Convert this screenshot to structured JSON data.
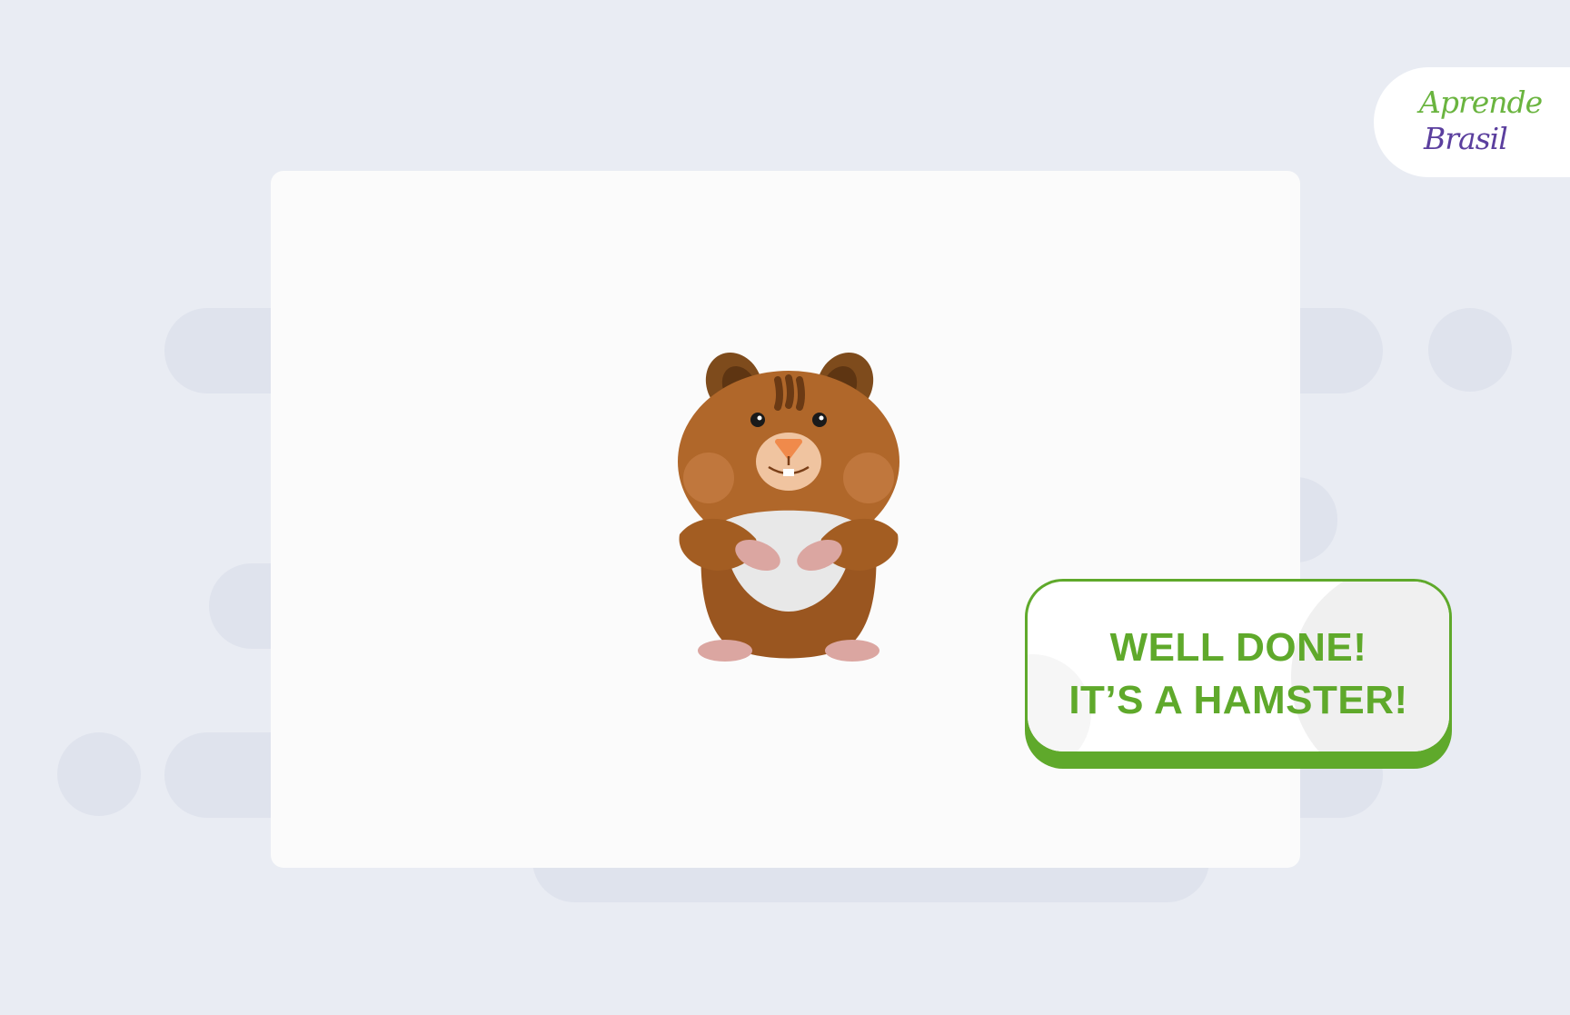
{
  "app": {
    "logo": {
      "line1": "Aprende",
      "line2": "Brasil"
    }
  },
  "activity": {
    "image_icon": "hamster-illustration"
  },
  "feedback": {
    "line1": "WELL DONE!",
    "line2": "IT’S A HAMSTER!"
  },
  "colors": {
    "background": "#e9ecf3",
    "card": "#fbfbfb",
    "success_green": "#5fa92b",
    "logo_green": "#6ab43f",
    "logo_purple": "#5b3f9e"
  }
}
